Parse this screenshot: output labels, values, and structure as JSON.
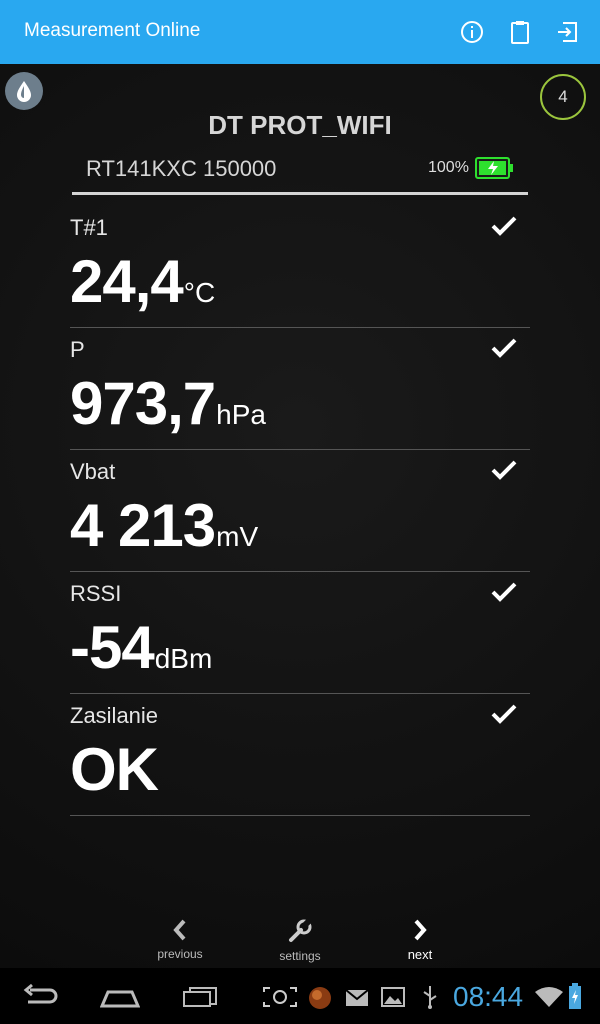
{
  "app": {
    "title": "Measurement Online",
    "accent_color": "#29a8f0",
    "actions": [
      "info-icon",
      "clipboard-icon",
      "exit-icon"
    ]
  },
  "header": {
    "counter": "4",
    "device_name": "DT PROT_WIFI",
    "serial": "RT141KXC 150000",
    "battery_percent": "100%"
  },
  "measurements": [
    {
      "label": "T#1",
      "value": "24,4",
      "unit": "°C",
      "status": "ok"
    },
    {
      "label": "P",
      "value": "973,7",
      "unit": "hPa",
      "status": "ok"
    },
    {
      "label": "Vbat",
      "value": "4 213",
      "unit": "mV",
      "status": "ok"
    },
    {
      "label": "RSSI",
      "value": "-54",
      "unit": "dBm",
      "status": "ok"
    },
    {
      "label": "Zasilanie",
      "value": "OK",
      "unit": "",
      "status": "ok"
    }
  ],
  "nav": {
    "previous": "previous",
    "settings": "settings",
    "next": "next"
  },
  "system": {
    "clock": "08:44"
  }
}
